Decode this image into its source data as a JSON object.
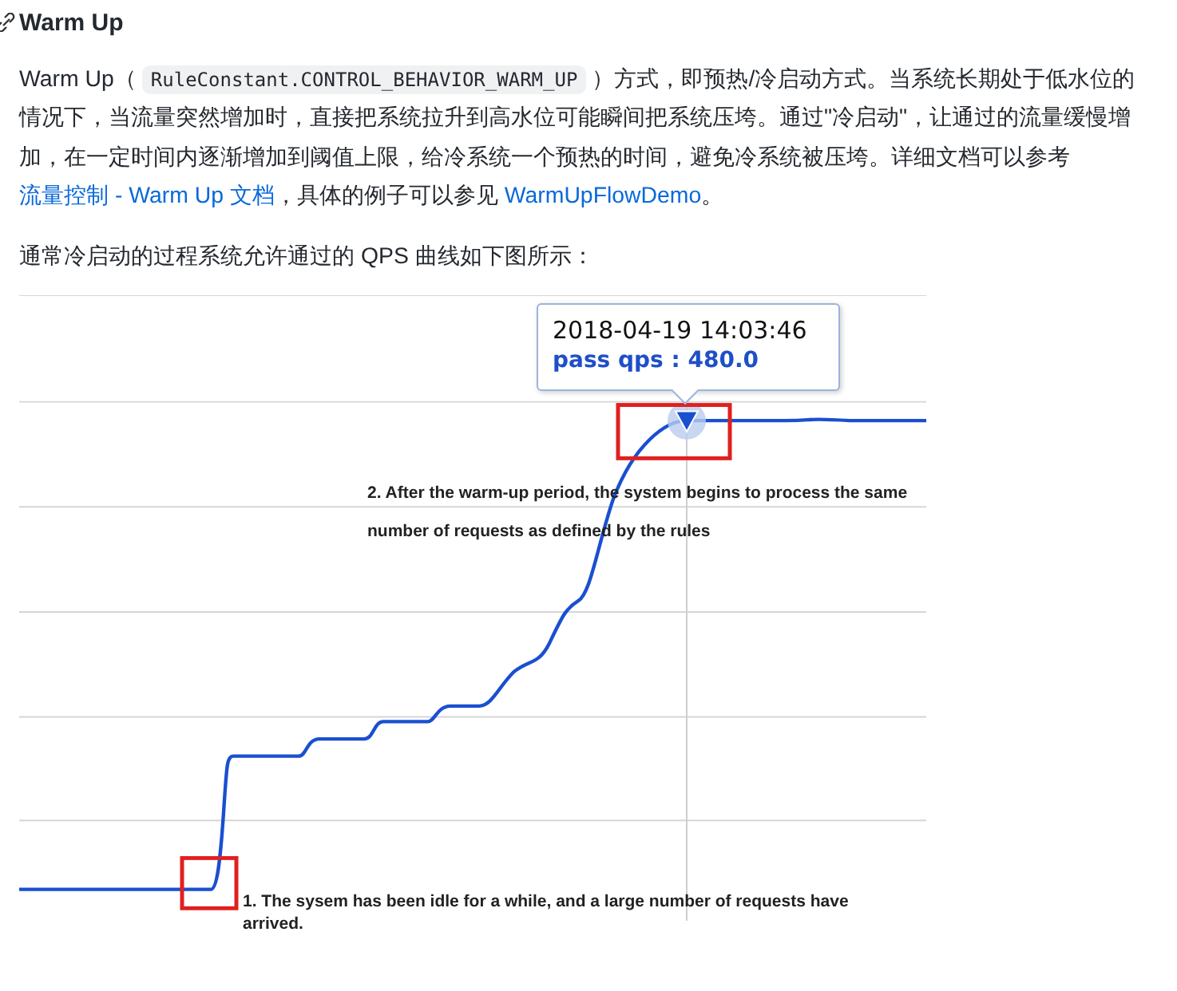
{
  "heading": "Warm Up",
  "paragraphs": [
    {
      "segments": [
        {
          "kind": "text",
          "text": "Warm Up（"
        },
        {
          "kind": "code",
          "text": "RuleConstant.CONTROL_BEHAVIOR_WARM_UP"
        },
        {
          "kind": "text",
          "text": "）方式，即预热/冷启动方式。当系统长期处于低水位的情况下，当流量突然增加时，直接把系统拉升到高水位可能瞬间把系统压垮。通过\"冷启动\"，让通过的流量缓慢增加，在一定时间内逐渐增加到阈值上限，给冷系统一个预热的时间，避免冷系统被压垮。详细文档可以参考 "
        },
        {
          "kind": "link",
          "text": "流量控制 - Warm Up 文档"
        },
        {
          "kind": "text",
          "text": "，具体的例子可以参见 "
        },
        {
          "kind": "link",
          "text": "WarmUpFlowDemo"
        },
        {
          "kind": "text",
          "text": "。"
        }
      ]
    },
    {
      "segments": [
        {
          "kind": "text",
          "text": "通常冷启动的过程系统允许通过的 QPS 曲线如下图所示："
        }
      ]
    }
  ],
  "chart": {
    "tooltip": {
      "time": "2018-04-19 14:03:46",
      "value": "pass qps : 480.0"
    },
    "annotations": [
      {
        "text": "2. After the warm-up period, the system begins to process the same number of requests as defined by the rules"
      },
      {
        "text": "1. The sysem has been idle for a while, and a large number of requests have arrived."
      }
    ]
  }
}
